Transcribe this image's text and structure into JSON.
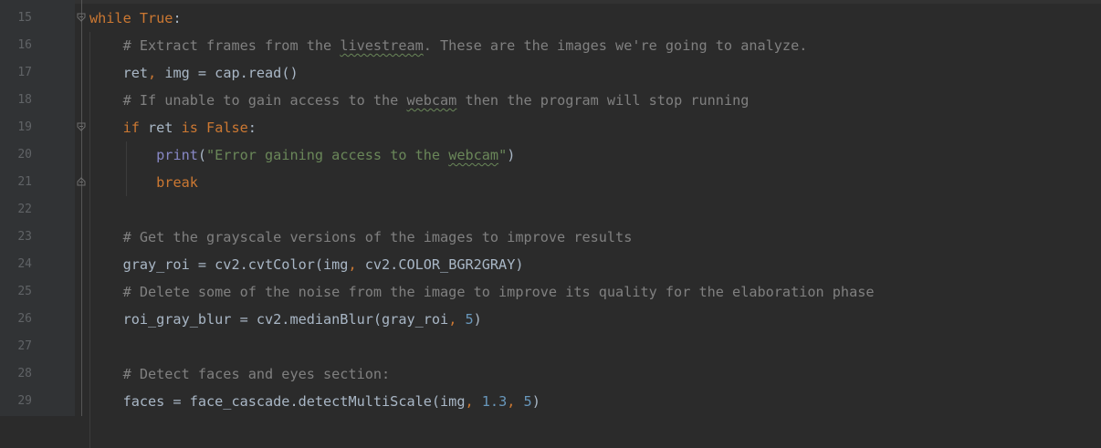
{
  "editor": {
    "colors": {
      "background": "#2b2b2b",
      "gutter_background": "#313335",
      "line_number": "#606366",
      "keyword": "#cc7832",
      "comment": "#808080",
      "string": "#6a8759",
      "number": "#6897bb",
      "builtin": "#8888c6",
      "plain": "#a9b7c6"
    },
    "fold_icons": [
      "fold-open-icon",
      "fold-open-icon",
      "fold-end-icon"
    ],
    "lines": [
      {
        "number": "15",
        "tokens": [
          {
            "t": "kw",
            "v": "while"
          },
          {
            "t": "plain",
            "v": " "
          },
          {
            "t": "kw",
            "v": "True"
          },
          {
            "t": "plain",
            "v": ":"
          }
        ]
      },
      {
        "number": "16",
        "tokens": [
          {
            "t": "comment",
            "v": "    # Extract frames from the "
          },
          {
            "t": "comment-typo",
            "v": "livestream"
          },
          {
            "t": "comment",
            "v": ". These are the images we're going to analyze."
          }
        ]
      },
      {
        "number": "17",
        "tokens": [
          {
            "t": "plain",
            "v": "    ret"
          },
          {
            "t": "kw",
            "v": ","
          },
          {
            "t": "plain",
            "v": " img = cap.read()"
          }
        ]
      },
      {
        "number": "18",
        "tokens": [
          {
            "t": "comment",
            "v": "    # If unable to gain access to the "
          },
          {
            "t": "comment-typo",
            "v": "webcam"
          },
          {
            "t": "comment",
            "v": " then the program will stop running"
          }
        ]
      },
      {
        "number": "19",
        "tokens": [
          {
            "t": "plain",
            "v": "    "
          },
          {
            "t": "kw",
            "v": "if"
          },
          {
            "t": "plain",
            "v": " ret "
          },
          {
            "t": "kw",
            "v": "is"
          },
          {
            "t": "plain",
            "v": " "
          },
          {
            "t": "kw",
            "v": "False"
          },
          {
            "t": "plain",
            "v": ":"
          }
        ]
      },
      {
        "number": "20",
        "tokens": [
          {
            "t": "plain",
            "v": "        "
          },
          {
            "t": "builtin",
            "v": "print"
          },
          {
            "t": "plain",
            "v": "("
          },
          {
            "t": "str",
            "v": "\"Error gaining access to the "
          },
          {
            "t": "str-typo",
            "v": "webcam"
          },
          {
            "t": "str",
            "v": "\""
          },
          {
            "t": "plain",
            "v": ")"
          }
        ]
      },
      {
        "number": "21",
        "tokens": [
          {
            "t": "plain",
            "v": "        "
          },
          {
            "t": "kw",
            "v": "break"
          }
        ]
      },
      {
        "number": "22",
        "tokens": []
      },
      {
        "number": "23",
        "tokens": [
          {
            "t": "comment",
            "v": "    # Get the grayscale versions of the images to improve results"
          }
        ]
      },
      {
        "number": "24",
        "tokens": [
          {
            "t": "plain",
            "v": "    gray_roi = cv2.cvtColor(img"
          },
          {
            "t": "kw",
            "v": ","
          },
          {
            "t": "plain",
            "v": " cv2.COLOR_BGR2GRAY)"
          }
        ]
      },
      {
        "number": "25",
        "tokens": [
          {
            "t": "comment",
            "v": "    # Delete some of the noise from the image to improve its quality for the elaboration phase"
          }
        ]
      },
      {
        "number": "26",
        "tokens": [
          {
            "t": "plain",
            "v": "    roi_gray_blur = cv2.medianBlur(gray_roi"
          },
          {
            "t": "kw",
            "v": ","
          },
          {
            "t": "plain",
            "v": " "
          },
          {
            "t": "num",
            "v": "5"
          },
          {
            "t": "plain",
            "v": ")"
          }
        ]
      },
      {
        "number": "27",
        "tokens": []
      },
      {
        "number": "28",
        "tokens": [
          {
            "t": "comment",
            "v": "    # Detect faces and eyes section:"
          }
        ]
      },
      {
        "number": "29",
        "tokens": [
          {
            "t": "plain",
            "v": "    faces = face_cascade.detectMultiScale(img"
          },
          {
            "t": "kw",
            "v": ","
          },
          {
            "t": "plain",
            "v": " "
          },
          {
            "t": "num",
            "v": "1.3"
          },
          {
            "t": "kw",
            "v": ","
          },
          {
            "t": "plain",
            "v": " "
          },
          {
            "t": "num",
            "v": "5"
          },
          {
            "t": "plain",
            "v": ")"
          }
        ]
      }
    ]
  }
}
